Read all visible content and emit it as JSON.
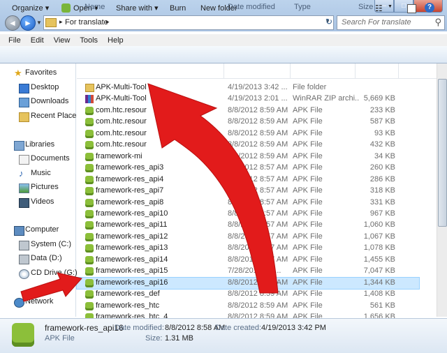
{
  "window": {
    "minimize": "–",
    "maximize": "□",
    "close": "✕"
  },
  "nav": {
    "back": "◄",
    "forward": "►",
    "dropdown": "▼",
    "refresh": "↻"
  },
  "address": {
    "separator": "▸",
    "path": "For translate",
    "dropdown": "▼"
  },
  "search": {
    "placeholder": "Search For translate",
    "icon": "search-icon"
  },
  "menu": [
    "File",
    "Edit",
    "View",
    "Tools",
    "Help"
  ],
  "toolbar": {
    "organize": "Organize ▾",
    "open": "Open ▾",
    "share": "Share with ▾",
    "burn": "Burn",
    "new_folder": "New folder",
    "view_dd": "▼",
    "help": "?"
  },
  "sidebar": {
    "favorites": "Favorites",
    "favorites_items": [
      "Desktop",
      "Downloads",
      "Recent Places"
    ],
    "libraries": "Libraries",
    "libraries_items": [
      "Documents",
      "Music",
      "Pictures",
      "Videos"
    ],
    "computer": "Computer",
    "computer_items": [
      "System (C:)",
      "Data (D:)",
      "CD Drive (G:) I"
    ],
    "network": "Network"
  },
  "columns": [
    "Name",
    "Date modified",
    "Type",
    "Size"
  ],
  "files": [
    {
      "name": "APK-Multi-Tool",
      "date": "4/19/2013 3:42 ...",
      "type": "File folder",
      "size": "",
      "icon": "folder"
    },
    {
      "name": "APK-Multi-Tool",
      "date": "4/19/2013 2:01 ...",
      "type": "WinRAR ZIP archi...",
      "size": "5,669 KB",
      "icon": "rar"
    },
    {
      "name": "com.htc.resour",
      "date": "8/8/2012 8:59 AM",
      "type": "APK File",
      "size": "233 KB",
      "icon": "apk"
    },
    {
      "name": "com.htc.resour",
      "date": "8/8/2012 8:59 AM",
      "type": "APK File",
      "size": "587 KB",
      "icon": "apk"
    },
    {
      "name": "com.htc.resour",
      "date": "8/8/2012 8:59 AM",
      "type": "APK File",
      "size": "93 KB",
      "icon": "apk"
    },
    {
      "name": "com.htc.resour",
      "date": "8/8/2012 8:59 AM",
      "type": "APK File",
      "size": "432 KB",
      "icon": "apk"
    },
    {
      "name": "framework-mi",
      "date": "8/8/2012 8:59 AM",
      "type": "APK File",
      "size": "34 KB",
      "icon": "apk"
    },
    {
      "name": "framework-res_api3",
      "date": "8/8/2012 8:57 AM",
      "type": "APK File",
      "size": "260 KB",
      "icon": "apk"
    },
    {
      "name": "framework-res_api4",
      "date": "8/8/2012 8:57 AM",
      "type": "APK File",
      "size": "286 KB",
      "icon": "apk"
    },
    {
      "name": "framework-res_api7",
      "date": "8/8/2012 8:57 AM",
      "type": "APK File",
      "size": "318 KB",
      "icon": "apk"
    },
    {
      "name": "framework-res_api8",
      "date": "8/8/2012 8:57 AM",
      "type": "APK File",
      "size": "331 KB",
      "icon": "apk"
    },
    {
      "name": "framework-res_api10",
      "date": "8/8/2012 8:57 AM",
      "type": "APK File",
      "size": "967 KB",
      "icon": "apk"
    },
    {
      "name": "framework-res_api11",
      "date": "8/8/2012 8:57 AM",
      "type": "APK File",
      "size": "1,060 KB",
      "icon": "apk"
    },
    {
      "name": "framework-res_api12",
      "date": "8/8/2012 8:57 AM",
      "type": "APK File",
      "size": "1,067 KB",
      "icon": "apk"
    },
    {
      "name": "framework-res_api13",
      "date": "8/8/2012 8:57 AM",
      "type": "APK File",
      "size": "1,078 KB",
      "icon": "apk"
    },
    {
      "name": "framework-res_api14",
      "date": "8/8/2012 8:57 AM",
      "type": "APK File",
      "size": "1,455 KB",
      "icon": "apk"
    },
    {
      "name": "framework-res_api15",
      "date": "7/28/2012 2:3...",
      "type": "APK File",
      "size": "7,047 KB",
      "icon": "apk"
    },
    {
      "name": "framework-res_api16",
      "date": "8/8/2012 8:58 AM",
      "type": "APK File",
      "size": "1,344 KB",
      "icon": "apk",
      "selected": true
    },
    {
      "name": "framework-res_def",
      "date": "8/8/2012 8:59 AM",
      "type": "APK File",
      "size": "1,408 KB",
      "icon": "apk"
    },
    {
      "name": "framework-res_htc",
      "date": "8/8/2012 8:59 AM",
      "type": "APK File",
      "size": "561 KB",
      "icon": "apk"
    },
    {
      "name": "framework-res_htc_4",
      "date": "8/8/2012 8:59 AM",
      "type": "APK File",
      "size": "1,656 KB",
      "icon": "apk"
    }
  ],
  "details": {
    "filename": "framework-res_api16",
    "filetype": "APK File",
    "date_modified_label": "Date modified:",
    "date_modified": "8/8/2012 8:58 AM",
    "size_label": "Size:",
    "size": "1.31 MB",
    "date_created_label": "Date created:",
    "date_created": "4/19/2013 3:42 PM"
  },
  "colors": {
    "annotation_red": "#e21b1b",
    "selection": "#cce8ff"
  }
}
